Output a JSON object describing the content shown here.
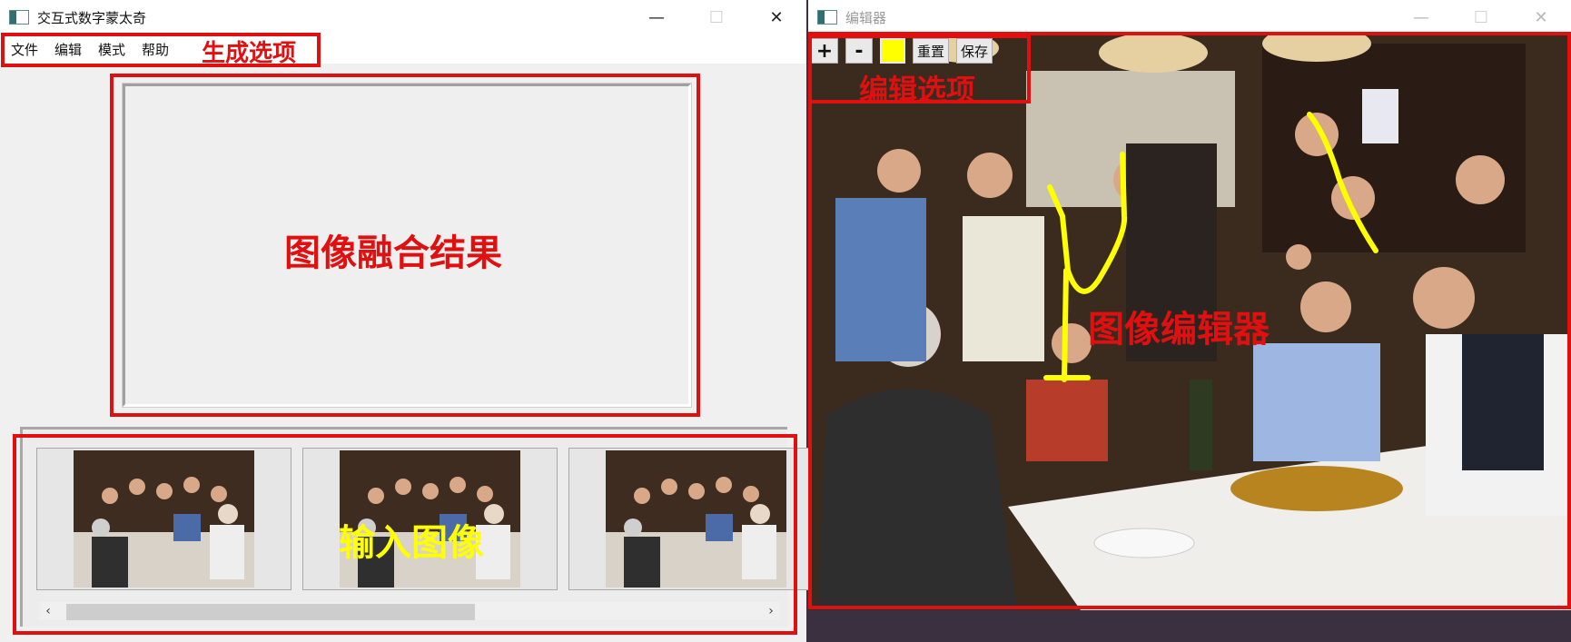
{
  "mosaic_window": {
    "title": "交互式数字蒙太奇",
    "controls": {
      "minimize": "—",
      "maximize": "☐",
      "close": "✕"
    },
    "menu": [
      "文件",
      "编辑",
      "模式",
      "帮助"
    ],
    "annotations": {
      "menu_label": "生成选项",
      "result_label": "图像融合结果",
      "thumbs_label": "输入图像"
    },
    "scroll": {
      "left": "‹",
      "right": "›"
    }
  },
  "editor_window": {
    "title": "编辑器",
    "controls": {
      "minimize": "—",
      "maximize": "☐",
      "close": "✕"
    },
    "toolbar": {
      "zoom_in": "+",
      "zoom_out": "-",
      "reset": "重置",
      "save": "保存"
    },
    "brush_color": "#ffff00",
    "annotations": {
      "toolbar_label": "编辑选项",
      "editor_label": "图像编辑器"
    }
  },
  "colors": {
    "annotation": "#e01010",
    "stroke": "#ffff00"
  }
}
